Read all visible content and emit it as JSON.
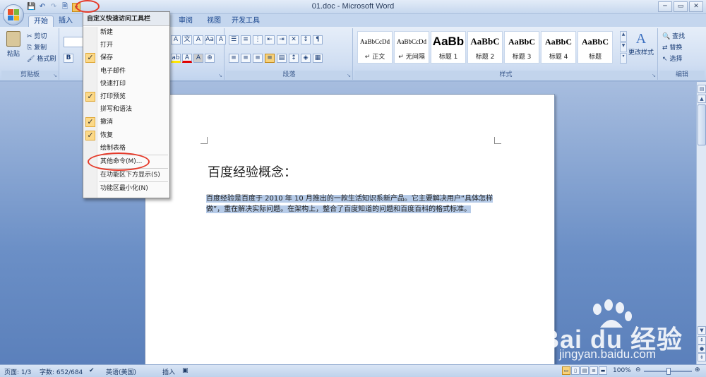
{
  "window": {
    "title": "01.doc - Microsoft Word",
    "controls": [
      "─",
      "▭",
      "✕"
    ]
  },
  "quick_access": {
    "icons": [
      "save-icon",
      "undo-icon",
      "redo-icon",
      "print-preview-icon"
    ],
    "dropdown_glyph": "▾"
  },
  "ribbon_tabs": [
    "开始",
    "插入",
    "审阅",
    "视图",
    "开发工具"
  ],
  "clipboard": {
    "paste": "粘贴",
    "cut": "剪切",
    "copy": "复制",
    "format_painter": "格式刷",
    "label": "剪贴板"
  },
  "font_group": {
    "bold": "B"
  },
  "paragraph_group": {
    "label": "段落"
  },
  "styles_group": {
    "label": "样式",
    "items": [
      {
        "sample": "AaBbCcDd",
        "name": "↵ 正文"
      },
      {
        "sample": "AaBbCcDd",
        "name": "↵ 无间隔"
      },
      {
        "sample": "AaBb",
        "name": "标题 1"
      },
      {
        "sample": "AaBbC",
        "name": "标题 2"
      },
      {
        "sample": "AaBbC",
        "name": "标题 3"
      },
      {
        "sample": "AaBbC",
        "name": "标题 4"
      },
      {
        "sample": "AaBbC",
        "name": "标题"
      }
    ],
    "change_styles": "更改样式"
  },
  "editing_group": {
    "find": "查找",
    "replace": "替换",
    "select": "选择",
    "label": "编辑"
  },
  "qat_menu": {
    "header": "自定义快速访问工具栏",
    "items": [
      {
        "label": "新建",
        "checked": false
      },
      {
        "label": "打开",
        "checked": false
      },
      {
        "label": "保存",
        "checked": true
      },
      {
        "label": "电子邮件",
        "checked": false
      },
      {
        "label": "快速打印",
        "checked": false
      },
      {
        "label": "打印预览",
        "checked": true
      },
      {
        "label": "拼写和语法",
        "checked": false
      },
      {
        "label": "撤消",
        "checked": true
      },
      {
        "label": "恢复",
        "checked": true
      },
      {
        "label": "绘制表格",
        "checked": false
      }
    ],
    "more_commands": "其他命令(M)...",
    "show_below": "在功能区下方显示(S)",
    "minimize": "功能区最小化(N)",
    "check_glyph": "✓"
  },
  "document": {
    "heading": "百度经验概念：",
    "body": "百度经验是百度于 2010 年 10 月推出的一款生活知识系新产品。它主要解决用户“具体怎样做”，重在解决实际问题。在架构上，整合了百度知道的问题和百度百科的格式标准。"
  },
  "status_bar": {
    "page": "页面: 1/3",
    "words": "字数: 652/684",
    "language": "英语(美国)",
    "mode": "插入",
    "zoom": "100%"
  },
  "watermark": {
    "brand": "Bai du 经验",
    "url": "jingyan.baidu.com"
  },
  "colors": {
    "accent": "#15428b",
    "highlight": "#b6cbe8",
    "annotation": "#e53a2a",
    "menu_check": "#fcd988"
  }
}
